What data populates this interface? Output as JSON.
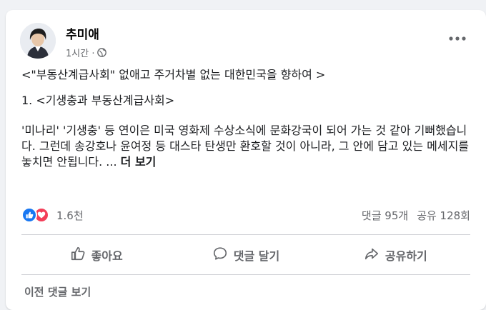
{
  "post": {
    "author": "추미애",
    "time": "1시간 ·",
    "title_line": "<\"부동산계급사회\" 없애고 주거차별 없는 대한민국을 향하여 >",
    "subtitle_line": "1. <기생충과 부동산계급사회>",
    "paragraph": "'미나리' '기생충' 등 연이은 미국 영화제 수상소식에 문화강국이 되어 가는 것 같아 기뻐했습니다. 그런데  송강호나 윤여정 등 대스타 탄생만 환호할 것이 아니라, 그 안에 담고 있는 메세지를 놓치면 안됩니다. ...",
    "see_more": "더 보기"
  },
  "stats": {
    "reaction_count": "1.6천",
    "comments": "댓글 95개",
    "shares": "공유 128회"
  },
  "actions": {
    "like": "좋아요",
    "comment": "댓글 달기",
    "share": "공유하기"
  },
  "footer": {
    "more_comments": "이전 댓글 보기"
  },
  "colors": {
    "like_blue": "#1877f2",
    "love_red": "#f33e58",
    "secondary_text": "#65676b"
  },
  "icons": {
    "globe": "globe-icon",
    "more": "more-options-icon",
    "like": "thumbs-up-icon",
    "comment": "comment-bubble-icon",
    "share": "share-arrow-icon"
  }
}
